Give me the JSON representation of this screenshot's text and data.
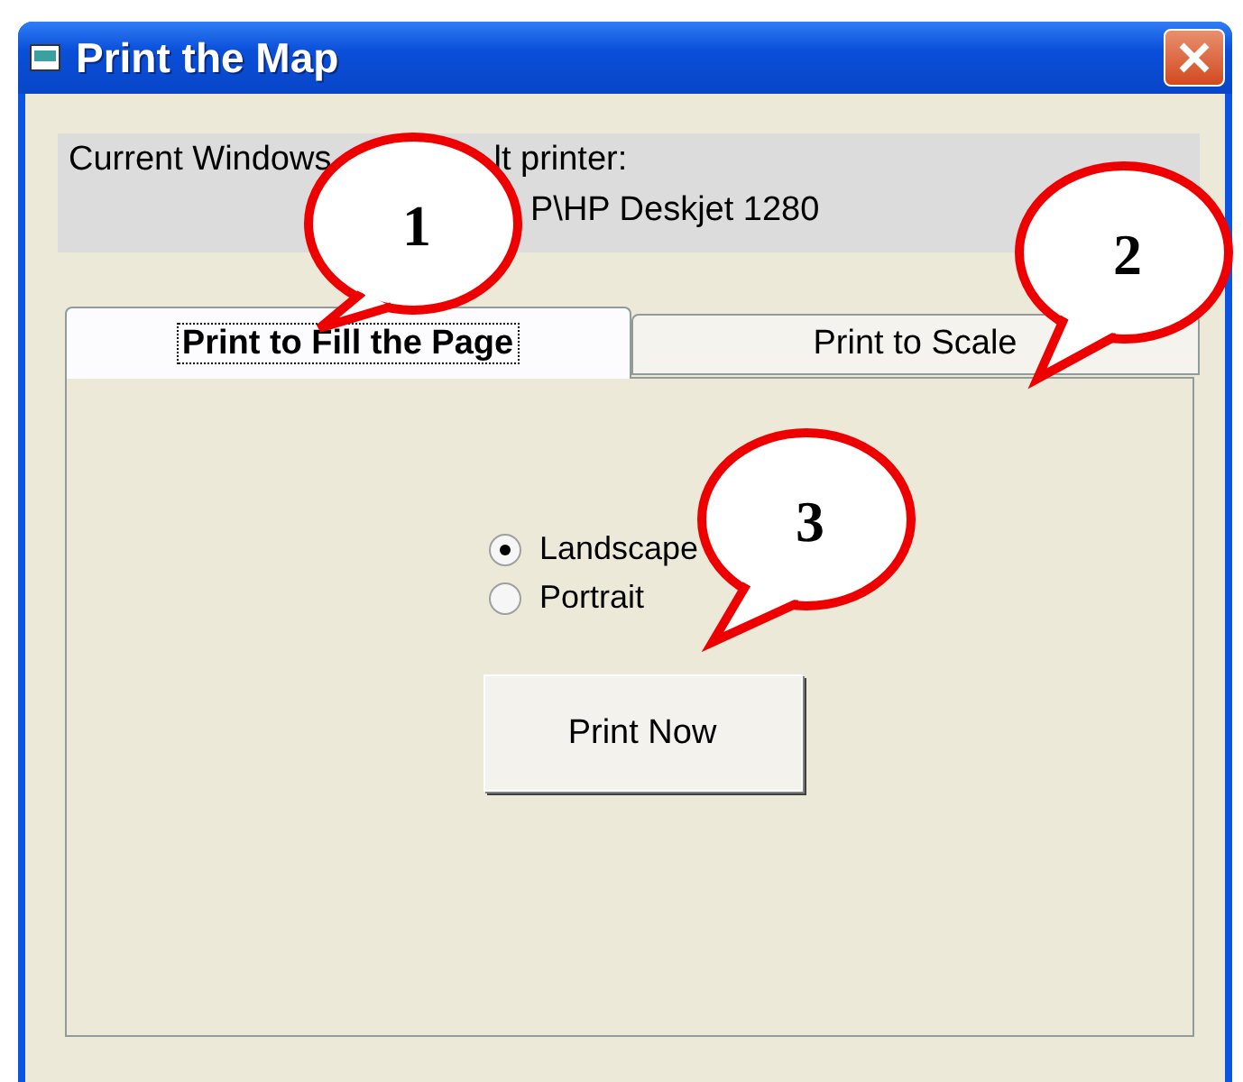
{
  "window": {
    "title": "Print the Map"
  },
  "printer_label": {
    "part_1": "Current Windows",
    "part_2": "lt printer:"
  },
  "printer_name": "P\\HP Deskjet 1280",
  "tabs": [
    {
      "label": "Print to Fill the Page",
      "selected": true
    },
    {
      "label": "Print to Scale",
      "selected": false
    }
  ],
  "orientation": [
    {
      "label": "Landscape",
      "selected": true
    },
    {
      "label": "Portrait",
      "selected": false
    }
  ],
  "buttons": [
    "Print Now"
  ],
  "callouts": [
    "1",
    "2",
    "3"
  ]
}
